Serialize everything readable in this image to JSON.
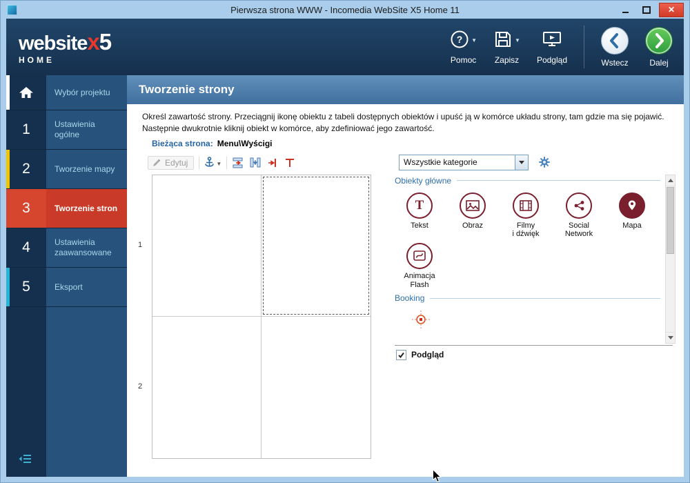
{
  "colors": {
    "header_navy": "#1a3a5e",
    "sidebar_blue": "#27527c",
    "active_red": "#c93b28",
    "accent_yellow": "#f0c400",
    "accent_cyan": "#27b4d6",
    "next_green": "#3aa94a",
    "object_maroon": "#7a1f2e"
  },
  "titlebar": {
    "title": "Pierwsza strona WWW - Incomedia WebSite X5 Home 11"
  },
  "header": {
    "logo": {
      "brand": "website",
      "x": "x",
      "five": "5",
      "sub": "HOME"
    },
    "buttons": {
      "help": "Pomoc",
      "save": "Zapisz",
      "preview": "Podgląd",
      "back": "Wstecz",
      "next": "Dalej"
    }
  },
  "sidebar": {
    "project": {
      "label": "Wybór projektu"
    },
    "steps": [
      {
        "num": "1",
        "label": "Ustawienia ogólne"
      },
      {
        "num": "2",
        "label": "Tworzenie mapy"
      },
      {
        "num": "3",
        "label": "Tworzenie stron"
      },
      {
        "num": "4",
        "label": "Ustawienia zaawansowane"
      },
      {
        "num": "5",
        "label": "Eksport"
      }
    ]
  },
  "page": {
    "title": "Tworzenie strony",
    "description": "Określ zawartość strony. Przeciągnij ikonę obiektu z tabeli dostępnych obiektów i upuść ją w komórce układu strony, tam gdzie ma się pojawić. Następnie dwukrotnie kliknij obiekt w komórce, aby zdefiniować jego zawartość.",
    "current_page_label": "Bieżąca strona:",
    "current_page_value": "Menu\\Wyścigi",
    "toolbar": {
      "edit": "Edytuj"
    },
    "grid": {
      "rows": [
        "1",
        "2"
      ]
    },
    "panel": {
      "category_filter": "Wszystkie kategorie",
      "section_main": "Obiekty główne",
      "objects": [
        {
          "label": "Tekst"
        },
        {
          "label": "Obraz"
        },
        {
          "label": "Filmy\ni dźwięk"
        },
        {
          "label": "Social\nNetwork"
        },
        {
          "label": "Mapa"
        },
        {
          "label": "Animacja\nFlash"
        }
      ],
      "section_booking": "Booking",
      "preview_label": "Podgląd"
    }
  }
}
